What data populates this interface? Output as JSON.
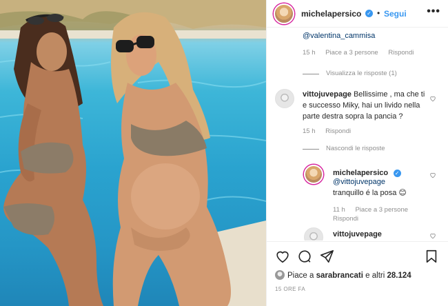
{
  "post": {
    "author": "michelapersico",
    "follow_label": "Segui",
    "separator": "•",
    "more_label": "•••"
  },
  "comments": {
    "top_reply": {
      "mention": "@valentina_cammisa",
      "time": "15 h",
      "likes": "Piace a 3 persone",
      "reply": "Rispondi"
    },
    "view_replies": "Visualizza le risposte (1)",
    "comment_2": {
      "author": "vittojuvepage",
      "text": "Bellissime , ma che ti e successo Miky, hai un livido nella parte destra sopra la pancia ?",
      "time": "15 h",
      "reply": "Rispondi"
    },
    "hide_replies": "Nascondi le risposte",
    "reply_2": {
      "author": "michelapersico",
      "mention": "@vittojuvepage",
      "text": "tranquillo é la posa",
      "emoji": "😊",
      "time": "11 h",
      "likes": "Piace a 3 persone",
      "reply": "Rispondi"
    },
    "comment_3": {
      "author": "vittojuvepage"
    }
  },
  "footer": {
    "likes_prefix": "Piace a",
    "likes_user": "sarabrancati",
    "likes_suffix": "e altri",
    "likes_count": "28.124",
    "timestamp": "15 ORE FA"
  },
  "colors": {
    "link_blue": "#3897f0",
    "mention_blue": "#003569",
    "muted": "#8e8e8e",
    "text": "#262626"
  }
}
